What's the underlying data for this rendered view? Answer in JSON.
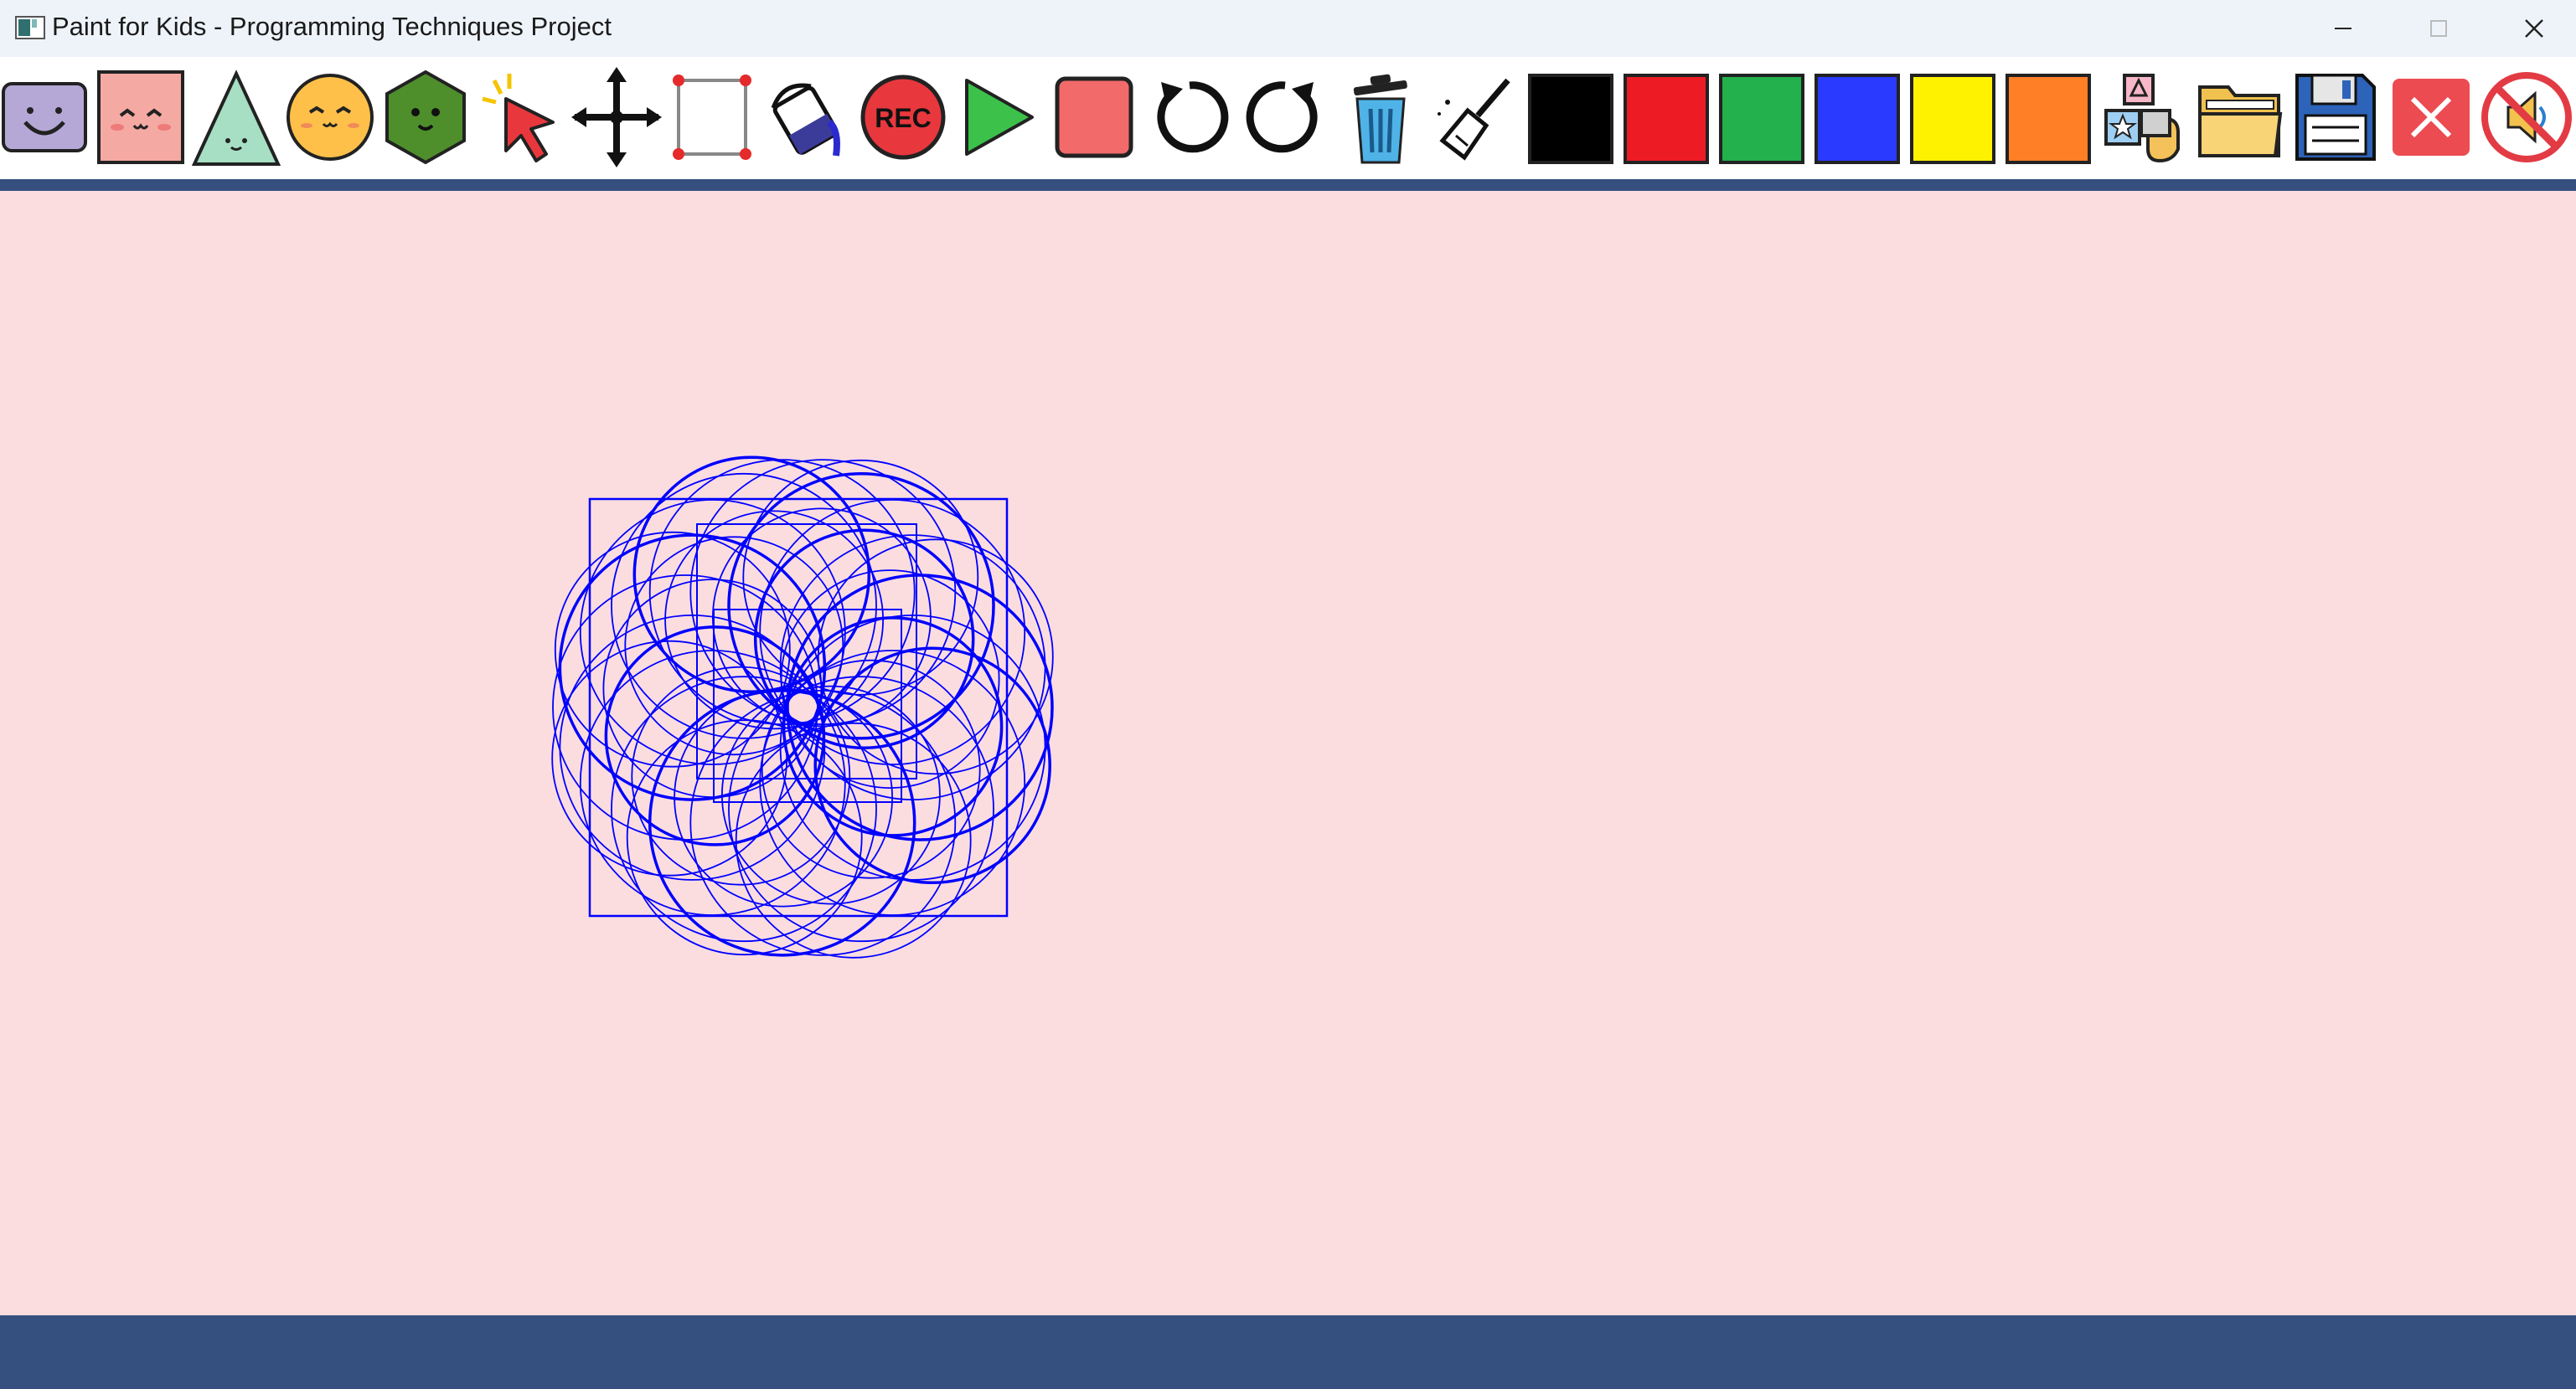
{
  "window": {
    "title": "Paint for Kids - Programming Techniques Project",
    "controls": [
      "minimize",
      "maximize",
      "close"
    ]
  },
  "toolbar": {
    "tools": [
      {
        "name": "rounded-square-shape",
        "icon": "smiley-square-icon"
      },
      {
        "name": "square-shape",
        "icon": "pink-face-square-icon"
      },
      {
        "name": "triangle-shape",
        "icon": "face-triangle-icon"
      },
      {
        "name": "circle-shape",
        "icon": "face-circle-icon"
      },
      {
        "name": "hexagon-shape",
        "icon": "face-hexagon-icon"
      },
      {
        "name": "select",
        "icon": "pointer-arrow-icon"
      },
      {
        "name": "move",
        "icon": "move-arrows-icon"
      },
      {
        "name": "resize",
        "icon": "resize-box-icon"
      },
      {
        "name": "fill",
        "icon": "paint-bucket-icon"
      },
      {
        "name": "record",
        "icon": "record-icon",
        "label": "REC"
      },
      {
        "name": "play",
        "icon": "play-icon"
      },
      {
        "name": "stop",
        "icon": "stop-icon"
      },
      {
        "name": "undo",
        "icon": "undo-icon"
      },
      {
        "name": "redo",
        "icon": "redo-icon"
      },
      {
        "name": "delete",
        "icon": "trash-icon"
      },
      {
        "name": "clear",
        "icon": "broom-icon"
      },
      {
        "name": "color-black",
        "icon": "color-swatch-icon",
        "color": "#000000"
      },
      {
        "name": "color-red",
        "icon": "color-swatch-icon",
        "color": "#ed1c24"
      },
      {
        "name": "color-green",
        "icon": "color-swatch-icon",
        "color": "#22b14c"
      },
      {
        "name": "color-blue",
        "icon": "color-swatch-icon",
        "color": "#2a3bff"
      },
      {
        "name": "color-yellow",
        "icon": "color-swatch-icon",
        "color": "#fff200"
      },
      {
        "name": "color-orange",
        "icon": "color-swatch-icon",
        "color": "#ff7f27"
      },
      {
        "name": "play-mode",
        "icon": "shape-blocks-icon"
      },
      {
        "name": "open",
        "icon": "folder-icon"
      },
      {
        "name": "save",
        "icon": "floppy-disk-icon"
      },
      {
        "name": "exit",
        "icon": "close-x-icon"
      },
      {
        "name": "mute",
        "icon": "no-sound-icon"
      }
    ]
  },
  "canvas": {
    "background": "#fbdde0",
    "stroke_color": "#0000ff",
    "drawing": "spirograph of overlapping circles with nested squares"
  },
  "status": {
    "text": ""
  },
  "colors": {
    "divider": "#35507f",
    "status_bar": "#35507f"
  }
}
